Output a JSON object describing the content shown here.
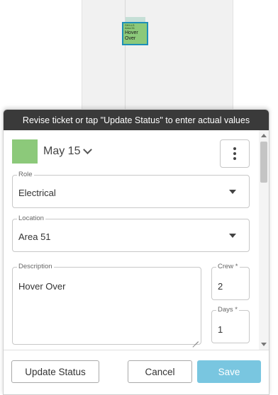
{
  "calendar_preview": {
    "card_small_line1": "SKILLS",
    "card_small_line2": "Area 51",
    "card_title": "Hover Over"
  },
  "dialog": {
    "header": "Revise ticket or tap \"Update Status\" to enter actual values",
    "date": "May 15",
    "swatch_color": "#8cc97a",
    "fields": {
      "role": {
        "label": "Role",
        "value": "Electrical"
      },
      "location": {
        "label": "Location",
        "value": "Area 51"
      },
      "description": {
        "label": "Description",
        "value": "Hover Over"
      },
      "crew": {
        "label": "Crew *",
        "value": "2"
      },
      "days": {
        "label": "Days *",
        "value": "1"
      }
    },
    "buttons": {
      "update_status": "Update Status",
      "cancel": "Cancel",
      "save": "Save"
    }
  },
  "colors": {
    "header_bg": "#3a3a3a",
    "save_button": "#79c6e0",
    "card_border": "#1e8fb8"
  }
}
